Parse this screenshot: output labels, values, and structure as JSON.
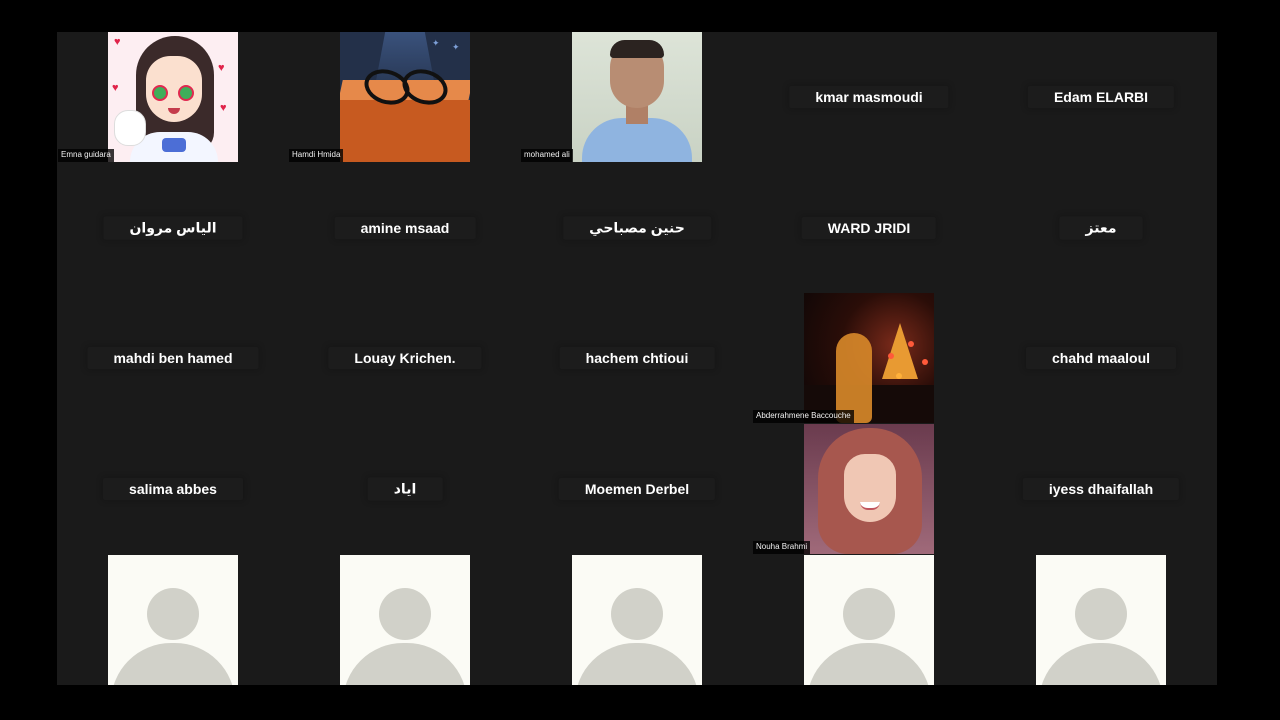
{
  "participants": {
    "emna": "Emna  guidara",
    "hamdi": "Hamdi Hmida",
    "mohamed": "mohamed ali",
    "kmar": "kmar masmoudi",
    "edam": "Edam ELARBI",
    "elyes": "الياس مروان",
    "amine": "amine msaad",
    "hanin": "حنين مصباحي",
    "ward": "WARD JRIDI",
    "moataz": "معتز",
    "mahdi": "mahdi ben hamed",
    "louay": "Louay Krichen.",
    "hachem": "hachem chtioui",
    "abderrahmene": "Abderrahmene Baccouche",
    "chahd": "chahd maaloul",
    "salima": "salima abbes",
    "iyad": "اياد",
    "moemen": "Moemen Derbel",
    "nouha": "Nouha Brahmi",
    "iyess": "iyess dhaifallah"
  },
  "icons": {
    "profile_placeholder": "person-silhouette-icon"
  }
}
